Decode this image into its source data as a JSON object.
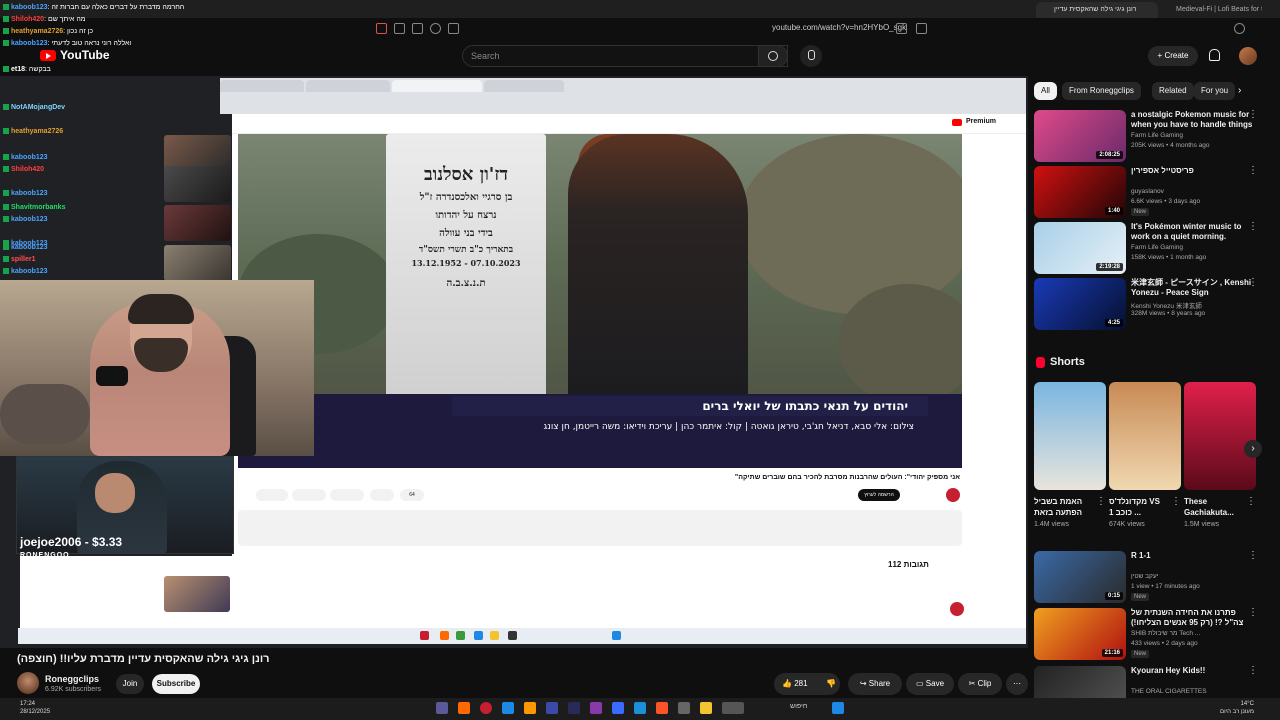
{
  "browser": {
    "active_tab": "רונן גיגי גילה שהאקסית עדיין",
    "tab_2": "Medieval-Fi | Lofi Beats for the",
    "url": "youtube.com/watch?v=hn2HYbO_sgk"
  },
  "header": {
    "logo": "YouTube",
    "search_placeholder": "Search",
    "create_label": "Create"
  },
  "chat": {
    "lines": [
      {
        "name": "kaboob123",
        "color": "#4aa3ff",
        "msg": ": החרמה מדברת על דברים כאלה עם חברות זה"
      },
      {
        "name": "Shiloh420",
        "color": "#ff4040",
        "msg": ": מה איתך שם"
      },
      {
        "name": "heathyama2726",
        "color": "#e0a030",
        "msg": ": כן זה נכון"
      },
      {
        "name": "kaboob123",
        "color": "#4aa3ff",
        "msg": ": ואללה רוני נראה טוב לדעתי"
      },
      {
        "name": "et18",
        "color": "#ffffff",
        "msg": ": בבקשה"
      },
      {
        "name": "NotAMojangDev",
        "color": "#7fd4ff",
        "msg": ""
      },
      {
        "name": "heathyama2726",
        "color": "#e0a030",
        "msg": ""
      },
      {
        "name": "kaboob123",
        "color": "#4aa3ff",
        "msg": ""
      },
      {
        "name": "Shiloh420",
        "color": "#ff4040",
        "msg": ""
      },
      {
        "name": "kaboob123",
        "color": "#4aa3ff",
        "msg": ""
      },
      {
        "name": "Shavitmorbanks",
        "color": "#22dd66",
        "msg": ""
      },
      {
        "name": "kaboob123",
        "color": "#4aa3ff",
        "msg": ""
      },
      {
        "name": "kaboob123",
        "color": "#4aa3ff",
        "msg": ""
      },
      {
        "name": "kaboob123",
        "color": "#4aa3ff",
        "msg": ""
      },
      {
        "name": "spiller1",
        "color": "#ff5050",
        "msg": ""
      },
      {
        "name": "kaboob123",
        "color": "#4aa3ff",
        "msg": ""
      }
    ]
  },
  "video_overlay": {
    "gravestone_lines": [
      "דז'ון אסלנוב",
      "בן סרגיי ואלכסנדרה ז\"ל",
      "נרצח על יהדותו",
      "בידי בני עוולה",
      "בתאריך כ\"ב תשרי תשס\"ד",
      "13.12.1952 - 07.10.2023",
      "ת.נ.צ.ב.ה"
    ],
    "caption_title": "יהודים על תנאי  כתבתו של יואלי ברים",
    "caption_credit": "צילום: אלי סבא, דניאל חג'בי, טיראן גואטה | קול: איתמר כהן | עריכת וידיאו: משה רייטמן, חן צונג",
    "inner_title": "\"אני מספיק יהודי\": העולים שהרבנות מסרבת להכיר בהם שוברים שתיקה",
    "inner_subscribe": "הרשמה לערוץ",
    "inner_likes": "64",
    "comments_count": "112 תגובות",
    "premium": "Premium"
  },
  "donation": {
    "text": "joejoe2006 - $3.33",
    "brand": "RONENGOO"
  },
  "video_info": {
    "title": "רונן גיגי גילה שהאקסית עדיין מדברת עליו!! (חוצפה)",
    "channel": "Roneggclips",
    "subscribers": "6.92K subscribers",
    "join": "Join",
    "subscribe": "Subscribe",
    "likes": "281",
    "share": "Share",
    "save": "Save",
    "clip": "Clip"
  },
  "chips": [
    "All",
    "From Roneggclips",
    "Related",
    "For you"
  ],
  "recommendations": [
    {
      "title": "a nostalgic Pokemon music for when you have to handle things",
      "channel": "Farm Life Gaming",
      "views": "205K views • 4 months ago",
      "duration": "2:08:25",
      "badge": "",
      "color_a": "#e04a8a",
      "color_b": "#6a2a6a"
    },
    {
      "title": "פריסטייל אספירין",
      "channel": "guyaslanov",
      "views": "6.6K views • 3 days ago",
      "duration": "1:40",
      "badge": "New",
      "color_a": "#d11010",
      "color_b": "#200606"
    },
    {
      "title": "It's Pokémon winter music to work on a quiet morning.",
      "channel": "Farm Life Gaming",
      "views": "158K views • 1 month ago",
      "duration": "2:19:28",
      "badge": "",
      "color_a": "#a8cfe8",
      "color_b": "#e6f0f6"
    },
    {
      "title": "米津玄師 - ピースサイン , Kenshi Yonezu - Peace Sign",
      "channel": "Kenshi Yonezu 米津玄師",
      "views": "328M views • 8 years ago",
      "duration": "4:25",
      "badge": "",
      "color_a": "#1a3ab8",
      "color_b": "#05102e"
    }
  ],
  "shorts": {
    "heading": "Shorts",
    "items": [
      {
        "title": "האמת בשביל הפתעה בזאת",
        "views": "1.4M views",
        "color_a": "#7ab6e0",
        "color_b": "#e8e4dc"
      },
      {
        "title": "מקדונלד'ס VS כוכב 1 ...",
        "views": "674K views",
        "color_a": "#c88a55",
        "color_b": "#f0d8b0"
      },
      {
        "title": "These Gachiakuta...",
        "views": "1.5M views",
        "color_a": "#e0204a",
        "color_b": "#5a0a1a"
      }
    ]
  },
  "recommendations_2": [
    {
      "title": "R 1-1",
      "channel": "יעקב שטין",
      "views": "1 view • 17 minutes ago",
      "duration": "0:15",
      "badge": "New",
      "color_a": "#3a6aa8",
      "color_b": "#2a2a2a"
    },
    {
      "title": "פתרנו את החידה השנתית של צה\"ל ?! (רק 95 אנשים הצליחו!)",
      "channel": "SHIB מר שיבולת Tech ...",
      "views": "433 views • 2 days ago",
      "duration": "21:16",
      "badge": "New",
      "color_a": "#f0a020",
      "color_b": "#b01010"
    },
    {
      "title": "Kyouran Hey Kids!!",
      "channel": "THE ORAL CIGARETTES",
      "views": "48K views • 3 months ago",
      "duration": "",
      "badge": "",
      "color_a": "#222222",
      "color_b": "#555555"
    }
  ],
  "taskbar": {
    "time": "17:24",
    "date": "28/12/2025",
    "search": "חיפוש",
    "temp": "14°C",
    "weather": "מעונן רב היום"
  }
}
